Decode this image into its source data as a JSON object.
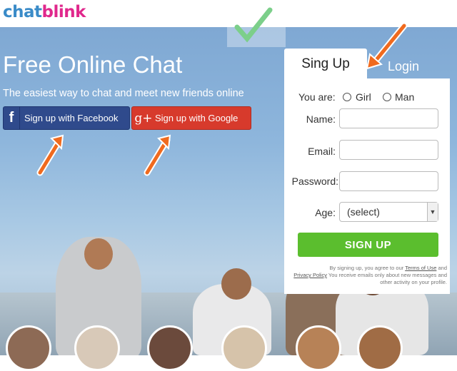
{
  "logo": {
    "part1": "chat",
    "part2": "blink"
  },
  "hero": {
    "title": "Free Online Chat",
    "tagline": "The easiest way to chat and meet new friends online"
  },
  "social": {
    "facebook_icon": "f",
    "facebook_label": "Sign up with Facebook",
    "google_icon": "g+",
    "google_label": "Sign up with Google"
  },
  "tabs": {
    "signup": "Sing Up",
    "login": "Login"
  },
  "form": {
    "you_are_label": "You are:",
    "girl_label": "Girl",
    "man_label": "Man",
    "name_label": "Name:",
    "email_label": "Email:",
    "password_label": "Password:",
    "age_label": "Age:",
    "age_selected": "(select)",
    "submit_label": "SIGN UP",
    "terms_prefix": "By signing up, you agree to our",
    "terms_link": "Terms of Use",
    "terms_and": "and",
    "privacy_link": "Privacy Policy",
    "terms_suffix": "You receive emails only about new messages and other activity on your profile."
  },
  "colors": {
    "facebook": "#2f4a8c",
    "google": "#d73a2c",
    "signup_button": "#5bbe2e",
    "arrow": "#f06a1e",
    "logo_blue": "#3a8bc8",
    "logo_pink": "#e0288c"
  }
}
